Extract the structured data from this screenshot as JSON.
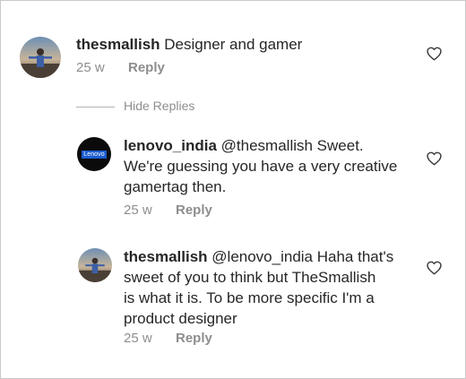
{
  "comments": [
    {
      "username": "thesmallish",
      "mention": "",
      "text": "Designer and gamer",
      "time": "25 w",
      "reply_label": "Reply"
    }
  ],
  "thread": {
    "hide_replies_label": "Hide Replies"
  },
  "replies": [
    {
      "username": "lenovo_india",
      "avatar_logo_text": "Lenovo",
      "text_lines": [
        "@thesmallish Sweet.",
        "We're guessing you have a very creative",
        "gamertag then."
      ],
      "time": "25 w",
      "reply_label": "Reply"
    },
    {
      "username": "thesmallish",
      "text_lines": [
        "@lenovo_india Haha that's",
        "sweet of you to think but TheSmallish",
        "is what it is. To be more specific I'm a",
        "product designer"
      ],
      "time": "25 w",
      "reply_label": "Reply"
    }
  ],
  "icons": {
    "like": "heart-outline-icon"
  },
  "colors": {
    "text": "#262626",
    "muted": "#8e8e8e",
    "lenovo_blue": "#1c5bd1"
  }
}
